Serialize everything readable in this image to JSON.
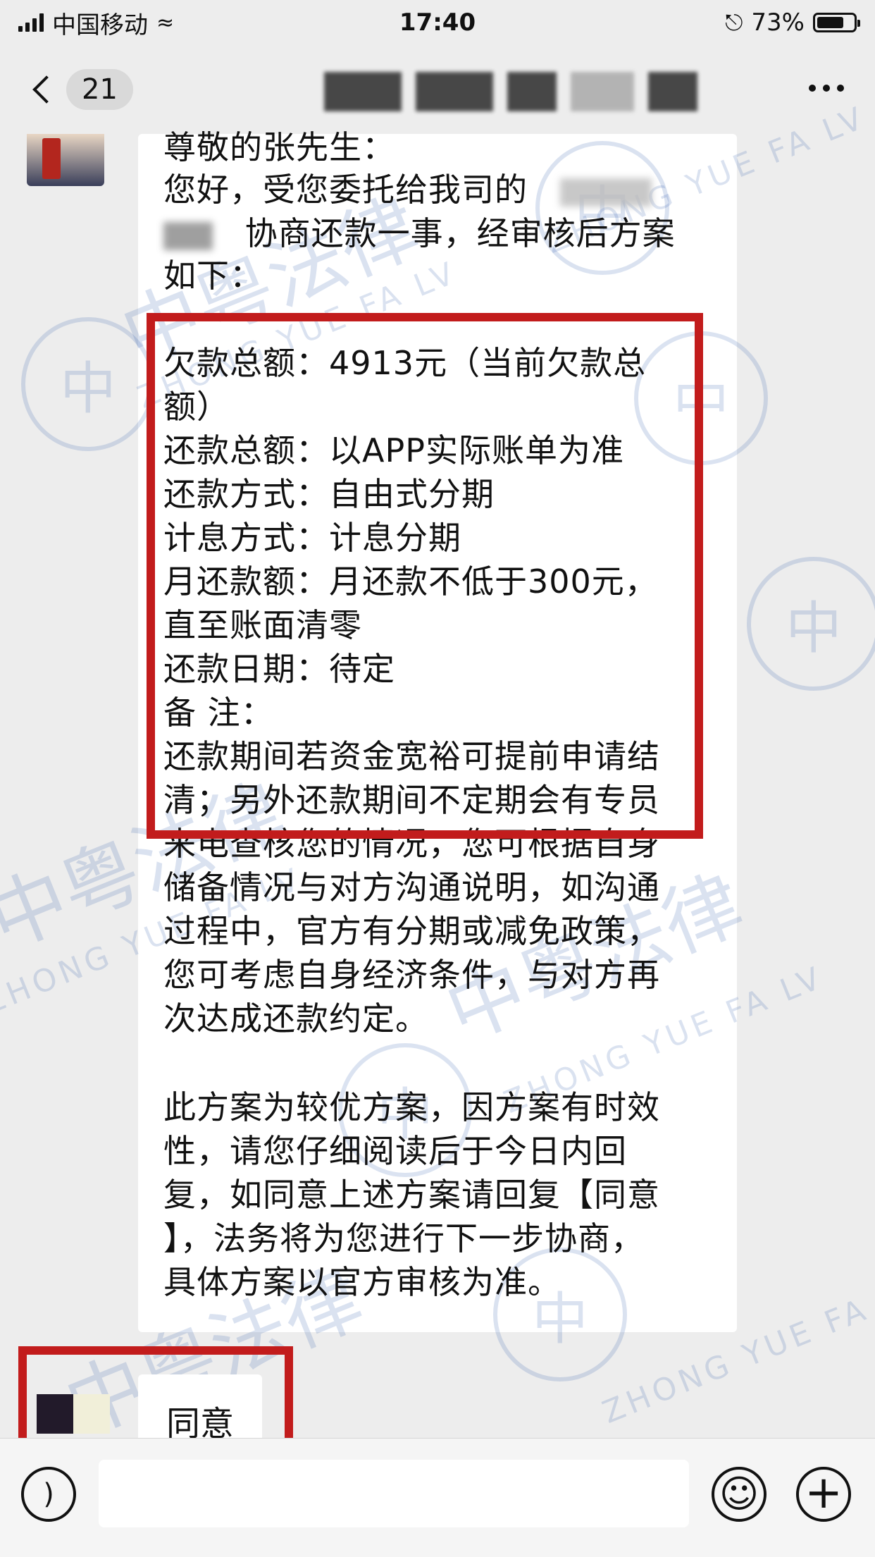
{
  "status_bar": {
    "carrier": "中国移动",
    "time": "17:40",
    "battery": "73%",
    "battery_level": 0.73
  },
  "nav": {
    "unread_count": "21"
  },
  "message": {
    "lines": [
      "尊敬的张先生：",
      "您好，受您委托给我司的",
      "协商还款一事，经审核后方案",
      "如下：",
      "欠款总额：4913元（当前欠款总",
      "额）",
      "还款总额：以APP实际账单为准",
      "还款方式：自由式分期",
      "计息方式：计息分期",
      "月还款额：月还款不低于300元，",
      "直至账面清零",
      "还款日期：待定",
      "备 注：",
      "还款期间若资金宽裕可提前申请结",
      "清；另外还款期间不定期会有专员",
      "来电查核您的情况，您可根据自身",
      "储备情况与对方沟通说明，如沟通",
      "过程中，官方有分期或减免政策，",
      "您可考虑自身经济条件，与对方再",
      "次达成还款约定。",
      "此方案为较优方案，因方案有时效",
      "性，请您仔细阅读后于今日内回",
      "复，如同意上述方案请回复【同意",
      "】，法务将为您进行下一步协商，",
      "具体方案以官方审核为准。"
    ]
  },
  "reply": {
    "text": "同意"
  },
  "watermark": {
    "chars": "中粤法律",
    "latin": "ZHONG YUE FA LV",
    "seal_char": "中"
  },
  "icons": {
    "signal": "signal-icon",
    "wifi": "wifi-icon",
    "lock": "rotation-lock-icon",
    "battery": "battery-icon",
    "back": "back-chevron-icon",
    "more": "more-icon",
    "voice": "voice-icon",
    "emoji": "emoji-icon",
    "plus": "plus-icon"
  }
}
